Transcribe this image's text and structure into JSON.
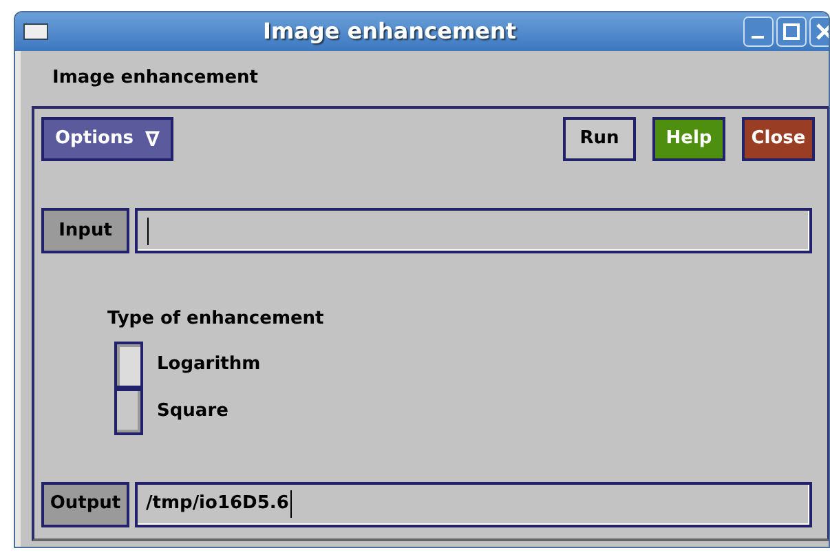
{
  "window": {
    "title": "Image enhancement"
  },
  "heading": "Image enhancement",
  "toolbar": {
    "menu": {
      "label": "Options",
      "icon": "∇"
    },
    "buttons": [
      {
        "label": "Run",
        "kind": "plain"
      },
      {
        "label": "Help",
        "kind": "help"
      },
      {
        "label": "Close",
        "kind": "close"
      }
    ]
  },
  "input": {
    "label": "Input"
  },
  "enhancement": {
    "label": "Type of enhancement",
    "options": [
      {
        "label": "Logarithm",
        "selected": true
      },
      {
        "label": "Square",
        "selected": false
      }
    ]
  },
  "output": {
    "label": "Output",
    "value": "/tmp/io16D5.6"
  }
}
